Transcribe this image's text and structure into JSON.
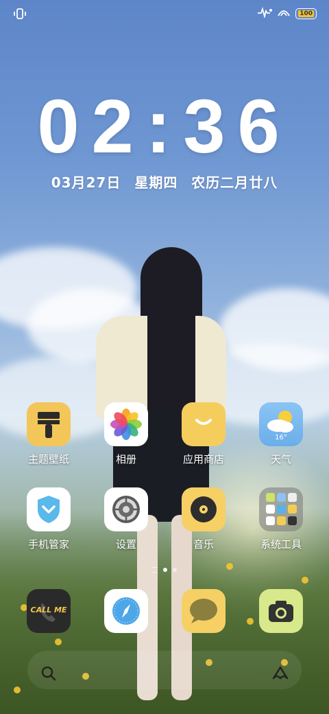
{
  "status_bar": {
    "battery": "100",
    "left_icon": "vibrate-icon",
    "right_icons": [
      "activity-icon",
      "nfc-icon",
      "battery-icon"
    ]
  },
  "lockscreen": {
    "time": "02:36",
    "date": "03月27日",
    "weekday": "星期四",
    "lunar": "农历二月廿八"
  },
  "apps": [
    {
      "label": "主题壁纸",
      "icon": "theme-brush-icon"
    },
    {
      "label": "相册",
      "icon": "photos-icon"
    },
    {
      "label": "应用商店",
      "icon": "app-store-icon"
    },
    {
      "label": "天气",
      "icon": "weather-icon",
      "temp": "16°"
    },
    {
      "label": "手机管家",
      "icon": "security-shield-icon"
    },
    {
      "label": "设置",
      "icon": "settings-gear-icon"
    },
    {
      "label": "音乐",
      "icon": "music-disc-icon"
    },
    {
      "label": "系统工具",
      "icon": "folder-icon"
    }
  ],
  "dock": [
    {
      "label": "CALL ME",
      "icon": "phone-icon"
    },
    {
      "icon": "browser-compass-icon"
    },
    {
      "icon": "messages-icon"
    },
    {
      "icon": "camera-icon"
    }
  ],
  "page_indicator": {
    "pages": 2,
    "current": 1
  },
  "colors": {
    "accent_yellow": "#f7cf5e",
    "clock": "#ffffff"
  }
}
